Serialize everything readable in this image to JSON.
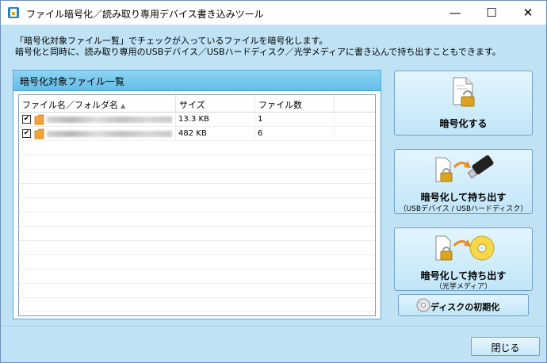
{
  "window": {
    "title": "ファイル暗号化／読み取り専用デバイス書き込みツール",
    "minimize": "—",
    "maximize": "☐",
    "close": "✕"
  },
  "description": {
    "line1": "「暗号化対象ファイル一覧」でチェックが入っているファイルを暗号化します。",
    "line2": "暗号化と同時に、読み取り専用のUSBデバイス／USBハードディスク／光学メディアに書き込んで持ち出すこともできます。"
  },
  "panel": {
    "title": "暗号化対象ファイル一覧",
    "columns": [
      "ファイル名／フォルダ名",
      "サイズ",
      "ファイル数"
    ],
    "rows": [
      {
        "checked": "✔",
        "size": "13.3 KB",
        "count": "1"
      },
      {
        "checked": "✔",
        "size": "482 KB",
        "count": "6"
      }
    ]
  },
  "buttons": {
    "encrypt": {
      "label": "暗号化する"
    },
    "encrypt_usb": {
      "label": "暗号化して持ち出す",
      "sub": "（USBデバイス / USBハードディスク）"
    },
    "encrypt_optical": {
      "label": "暗号化して持ち出す",
      "sub": "（光学メディア）"
    },
    "disk_init": {
      "label": "ディスクの初期化"
    },
    "close": {
      "label": "閉じる"
    }
  },
  "colors": {
    "accent": "#63bde8",
    "background": "#bfe3f5",
    "lock_gold": "#d9a520"
  }
}
